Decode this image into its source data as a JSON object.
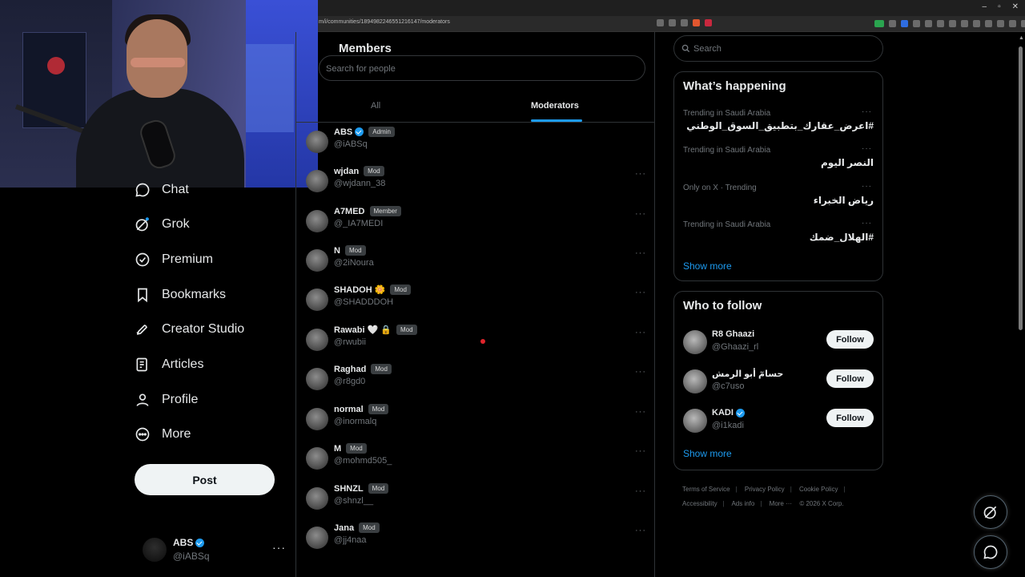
{
  "browser": {
    "url": "m/i/communities/1894982246551216147/moderators",
    "window_controls": [
      "–",
      "▫",
      "✕"
    ]
  },
  "nav": {
    "items": [
      {
        "label": "Chat",
        "icon": "chat-icon"
      },
      {
        "label": "Grok",
        "icon": "grok-icon"
      },
      {
        "label": "Premium",
        "icon": "premium-icon"
      },
      {
        "label": "Bookmarks",
        "icon": "bookmark-icon"
      },
      {
        "label": "Creator Studio",
        "icon": "rocket-icon"
      },
      {
        "label": "Articles",
        "icon": "article-icon"
      },
      {
        "label": "Profile",
        "icon": "profile-icon"
      },
      {
        "label": "More",
        "icon": "more-circle-icon"
      }
    ],
    "post_label": "Post",
    "account": {
      "name": "ABS",
      "handle": "@iABSq",
      "more": "···"
    }
  },
  "members": {
    "title": "Members",
    "search_placeholder": "Search for people",
    "tabs": [
      {
        "label": "All",
        "active": false
      },
      {
        "label": "Moderators",
        "active": true
      }
    ],
    "list": [
      {
        "name": "ABS",
        "verified": true,
        "emoji": "",
        "badge": "Admin",
        "handle": "@iABSq",
        "more": ""
      },
      {
        "name": "wjdan",
        "verified": false,
        "emoji": "",
        "badge": "Mod",
        "handle": "@wjdann_38",
        "more": "···"
      },
      {
        "name": "A7MED",
        "verified": false,
        "emoji": "",
        "badge": "Member",
        "handle": "@_IA7MEDI",
        "more": "···"
      },
      {
        "name": "N",
        "verified": false,
        "emoji": "",
        "badge": "Mod",
        "handle": "@2iNoura",
        "more": "···"
      },
      {
        "name": "SHADOH",
        "verified": false,
        "emoji": "🌼",
        "badge": "Mod",
        "handle": "@SHADDDOH",
        "more": "···"
      },
      {
        "name": "Rawabi",
        "verified": false,
        "emoji": "🤍 🔒",
        "badge": "Mod",
        "handle": "@rwubii",
        "more": "···"
      },
      {
        "name": "Raghad",
        "verified": false,
        "emoji": "",
        "badge": "Mod",
        "handle": "@r8gd0",
        "more": "···"
      },
      {
        "name": "normal",
        "verified": false,
        "emoji": "",
        "badge": "Mod",
        "handle": "@inormalq",
        "more": "···"
      },
      {
        "name": "M",
        "verified": false,
        "emoji": "",
        "badge": "Mod",
        "handle": "@mohmd505_",
        "more": "···"
      },
      {
        "name": "SHNZL",
        "verified": false,
        "emoji": "",
        "badge": "Mod",
        "handle": "@shnzl__",
        "more": "···"
      },
      {
        "name": "Jana",
        "verified": false,
        "emoji": "",
        "badge": "Mod",
        "handle": "@jj4naa",
        "more": "···"
      }
    ]
  },
  "sidebar": {
    "search_placeholder": "Search",
    "happening": {
      "title": "What’s happening",
      "trends": [
        {
          "context": "Trending in Saudi Arabia",
          "name": "#اعرض_عقارك_بتطبيق_السوق_الوطني",
          "more": "···"
        },
        {
          "context": "Trending in Saudi Arabia",
          "name": "النصر اليوم",
          "more": "···"
        },
        {
          "context": "Only on X · Trending",
          "name": "رياض الخبراء",
          "more": "···"
        },
        {
          "context": "Trending in Saudi Arabia",
          "name": "#الهلال_ضمك",
          "more": "···"
        }
      ],
      "show_more": "Show more"
    },
    "who_to_follow": {
      "title": "Who to follow",
      "accounts": [
        {
          "name": "R8 Ghaazi",
          "verified": false,
          "handle": "@Ghaazi_rl",
          "button": "Follow"
        },
        {
          "name": "حسامٓ أبو الرمش",
          "verified": false,
          "handle": "@c7uso",
          "button": "Follow"
        },
        {
          "name": "KADI",
          "verified": true,
          "handle": "@i1kadi",
          "button": "Follow"
        }
      ],
      "show_more": "Show more"
    },
    "footer": {
      "row1": [
        "Terms of Service",
        "Privacy Policy",
        "Cookie Policy"
      ],
      "row2": [
        "Accessibility",
        "Ads info",
        "More ···",
        "© 2026 X Corp."
      ]
    }
  },
  "colors": {
    "accent": "#1d9bf0",
    "background": "#000000",
    "border": "#2f3336",
    "muted": "#71767b"
  }
}
